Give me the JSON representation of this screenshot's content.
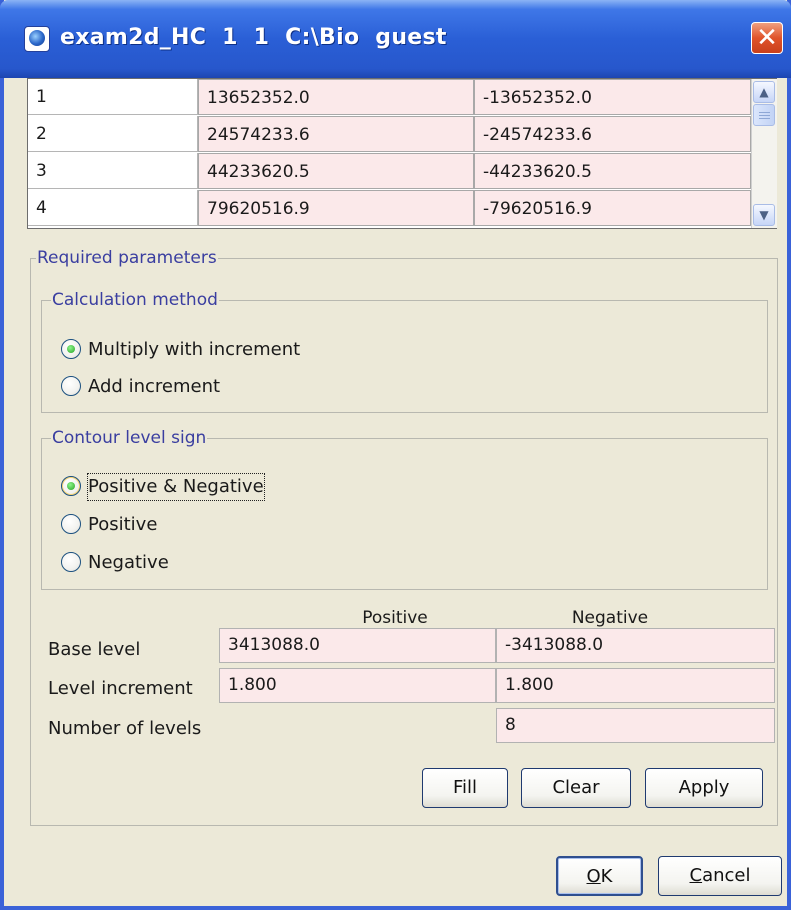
{
  "window": {
    "title": "exam2d_HC  1  1  C:\\Bio  guest",
    "app_icon": "topspin-icon",
    "close_glyph": "✕"
  },
  "level_table": {
    "rows": [
      {
        "index": "1",
        "positive": "13652352.0",
        "negative": "-13652352.0"
      },
      {
        "index": "2",
        "positive": "24574233.6",
        "negative": "-24574233.6"
      },
      {
        "index": "3",
        "positive": "44233620.5",
        "negative": "-44233620.5"
      },
      {
        "index": "4",
        "positive": "79620516.9",
        "negative": "-79620516.9"
      }
    ],
    "scroll_up_glyph": "▲",
    "scroll_down_glyph": "▼"
  },
  "required": {
    "legend": "Required parameters",
    "calc_method": {
      "legend": "Calculation method",
      "options": [
        "Multiply with increment",
        "Add increment"
      ],
      "selected": "Multiply with increment"
    },
    "contour_sign": {
      "legend": "Contour level sign",
      "options": [
        "Positive & Negative",
        "Positive",
        "Negative"
      ],
      "selected": "Positive & Negative"
    },
    "levels": {
      "col_positive": "Positive",
      "col_negative": "Negative",
      "base_level_label": "Base level",
      "base_level_positive": "3413088.0",
      "base_level_negative": "-3413088.0",
      "increment_label": "Level increment",
      "increment_positive": "1.800",
      "increment_negative": "1.800",
      "num_levels_label": "Number of levels",
      "num_levels": "8"
    },
    "buttons": {
      "fill": "Fill",
      "clear": "Clear",
      "apply": "Apply"
    }
  },
  "footer": {
    "ok_mnemonic": "O",
    "ok_rest": "K",
    "cancel_mnemonic": "C",
    "cancel_rest": "ancel"
  },
  "colors": {
    "titlebar": "#2a5fd6",
    "field_bg": "#fbe9ea",
    "legend_text": "#3a3ea0",
    "dialog_bg": "#ece9d8"
  }
}
